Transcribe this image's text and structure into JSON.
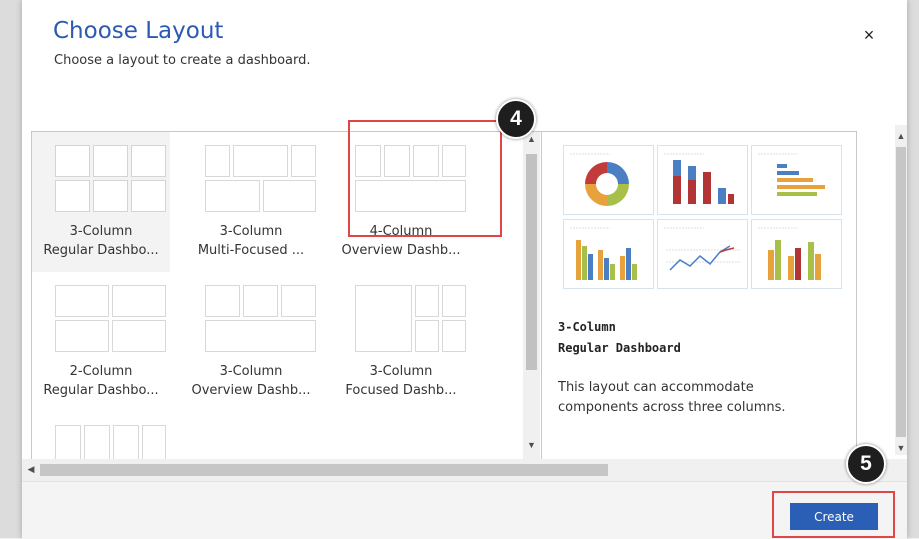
{
  "dialog": {
    "title": "Choose Layout",
    "subtitle": "Choose a layout to create a dashboard.",
    "close_label": "×",
    "create_label": "Create"
  },
  "layouts": [
    {
      "line1": "3-Column",
      "line2": "Regular Dashbo..."
    },
    {
      "line1": "3-Column",
      "line2": "Multi-Focused ..."
    },
    {
      "line1": "4-Column",
      "line2": "Overview Dashb..."
    },
    {
      "line1": "2-Column",
      "line2": "Regular Dashbo..."
    },
    {
      "line1": "3-Column",
      "line2": "Overview Dashb..."
    },
    {
      "line1": "3-Column",
      "line2": "Focused Dashb..."
    }
  ],
  "preview": {
    "name_line1": "3-Column",
    "name_line2": "Regular Dashboard",
    "description": "This layout can accommodate components across three columns."
  },
  "annotations": {
    "badge_4": "4",
    "badge_5": "5"
  },
  "colors": {
    "accent": "#2b5fb6",
    "title": "#2a5ab2",
    "highlight": "#e04646",
    "badge": "#1e1e1e"
  }
}
